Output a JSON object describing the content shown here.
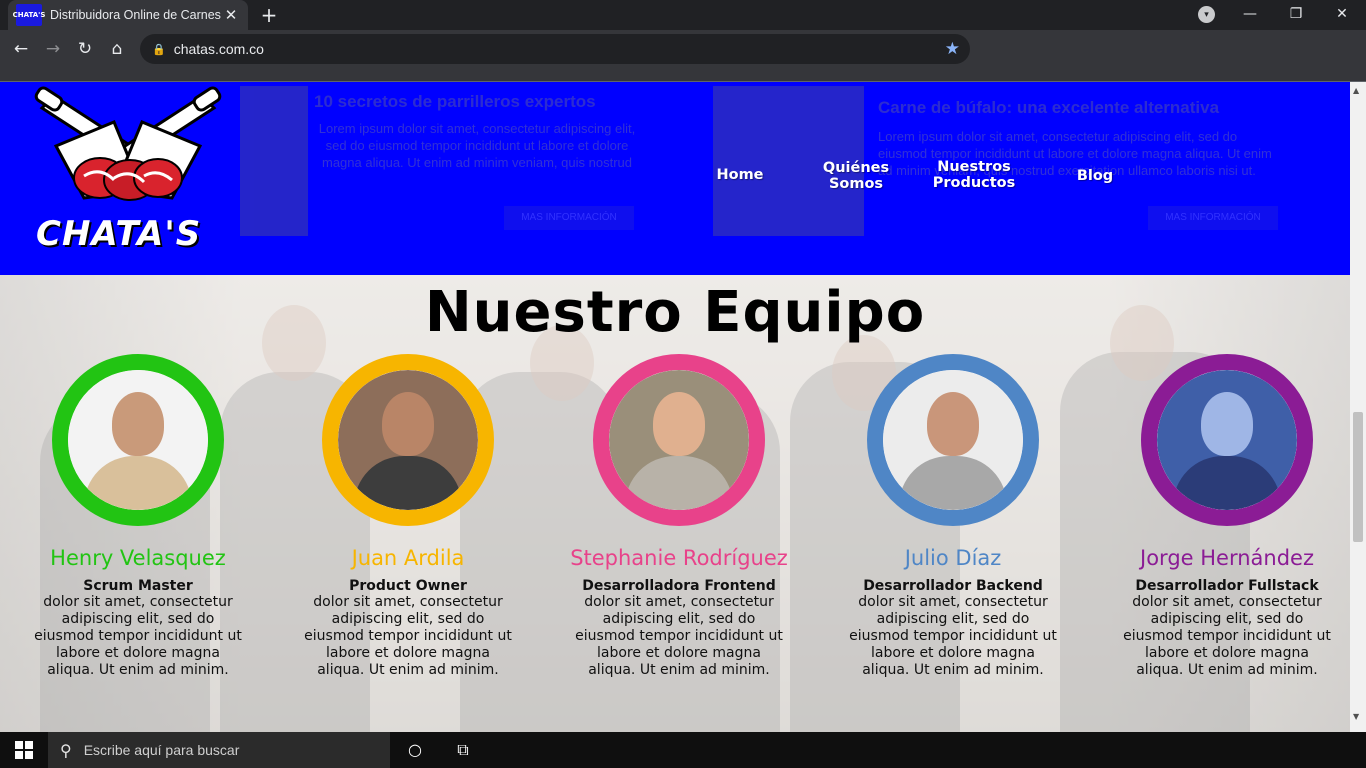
{
  "browser": {
    "tab_title": "Distribuidora Online de Carnes",
    "favicon_text": "CHATA'S",
    "url": "chatas.com.co",
    "icons": {
      "back": "arrow-left-icon",
      "forward": "arrow-right-icon",
      "reload": "reload-icon",
      "home": "home-icon",
      "lock": "lock-icon",
      "bookmark": "star-icon",
      "new_tab": "plus-icon",
      "close_tab": "close-icon",
      "minimize": "minimize-icon",
      "restore": "restore-icon",
      "close_window": "close-icon"
    }
  },
  "header": {
    "background_color": "#0000ff",
    "logo_text": "CHATA'S",
    "nav": [
      {
        "label": "Home"
      },
      {
        "label": "Quiénes Somos"
      },
      {
        "label": "Nuestros Productos"
      },
      {
        "label": "Blog"
      }
    ],
    "ghost_cards": [
      {
        "title": "10 secretos de parrilleros expertos",
        "text": "Lorem ipsum dolor sit amet, consectetur adipiscing elit, sed do eiusmod tempor incididunt ut labore et dolore magna aliqua. Ut enim ad minim veniam, quis nostrud",
        "button": "MAS INFORMACIÓN"
      },
      {
        "title": "Carne de búfalo: una excelente alternativa",
        "text": "Lorem ipsum dolor sit amet, consectetur adipiscing elit, sed do eiusmod tempor incididunt ut labore et dolore magna aliqua. Ut enim ad minim veniam, quis nostrud exercitation ullamco laboris nisi ut.",
        "button": "MAS INFORMACIÓN"
      }
    ]
  },
  "team": {
    "title": "Nuestro Equipo",
    "members": [
      {
        "name": "Henry Velasquez",
        "role": "Scrum Master",
        "color": "#22c413",
        "desc": "dolor sit amet, consectetur adipiscing elit, sed do eiusmod tempor incididunt ut labore et dolore magna aliqua. Ut enim ad minim."
      },
      {
        "name": "Juan Ardila",
        "role": "Product Owner",
        "color": "#f7b500",
        "desc": "dolor sit amet, consectetur adipiscing elit, sed do eiusmod tempor incididunt ut labore et dolore magna aliqua. Ut enim ad minim."
      },
      {
        "name": "Stephanie Rodríguez",
        "role": "Desarrolladora Frontend",
        "color": "#e8428a",
        "desc": "dolor sit amet, consectetur adipiscing elit, sed do eiusmod tempor incididunt ut labore et dolore magna aliqua. Ut enim ad minim."
      },
      {
        "name": "Julio Díaz",
        "role": "Desarrollador Backend",
        "color": "#4f86c6",
        "desc": "dolor sit amet, consectetur adipiscing elit, sed do eiusmod tempor incididunt ut labore et dolore magna aliqua. Ut enim ad minim."
      },
      {
        "name": "Jorge Hernández",
        "role": "Desarrollador Fullstack",
        "color": "#8b1c95",
        "desc": "dolor sit amet, consectetur adipiscing elit, sed do eiusmod tempor incididunt ut labore et dolore magna aliqua. Ut enim ad minim."
      }
    ]
  },
  "taskbar": {
    "search_placeholder": "Escribe aquí para buscar",
    "icons": [
      "windows-start-icon",
      "search-icon",
      "cortana-icon",
      "task-view-icon"
    ]
  }
}
